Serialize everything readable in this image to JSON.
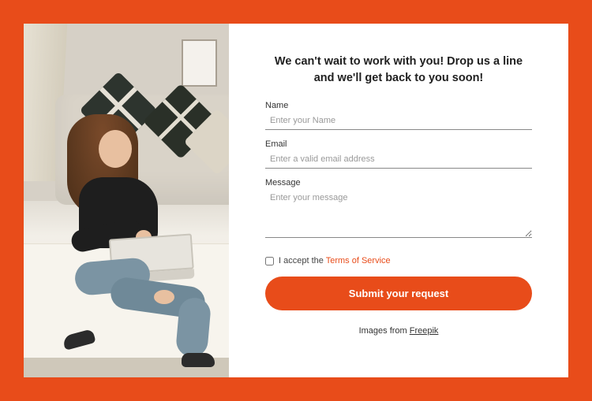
{
  "heading": "We can't wait to work with you! Drop us a line and we'll get back to you soon!",
  "fields": {
    "name": {
      "label": "Name",
      "placeholder": "Enter your Name"
    },
    "email": {
      "label": "Email",
      "placeholder": "Enter a valid email address"
    },
    "message": {
      "label": "Message",
      "placeholder": "Enter your message"
    }
  },
  "terms": {
    "prefix": "I accept the ",
    "link": "Terms of Service"
  },
  "submit_label": "Submit your request",
  "credit": {
    "prefix": "Images from ",
    "link": "Freepik"
  }
}
